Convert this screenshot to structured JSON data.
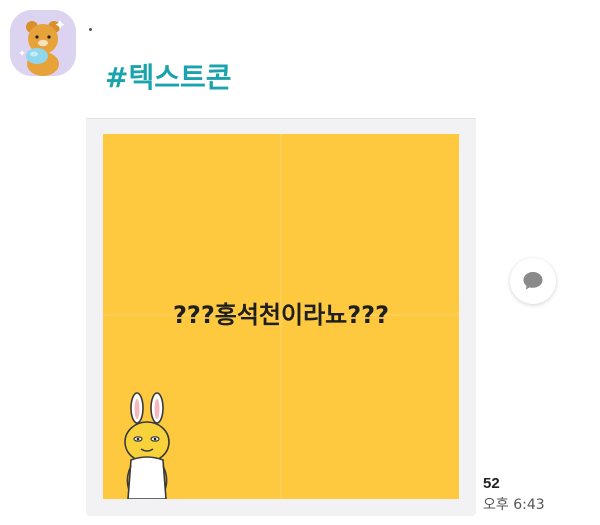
{
  "message": {
    "sender_avatar_icon": "ryan-bear-avatar-icon",
    "avatar_background": "#dcd3f0",
    "hashtag_title": "#텍스트콘",
    "hashtag_color": "#1aa3ad",
    "emoticon": {
      "text": "???홍석천이라뇨???",
      "background_color": "#fec93f",
      "character_icon": "rabbit-character-icon"
    },
    "reply_icon": "speech-bubble-icon",
    "unread_count": "52",
    "timestamp": "오후 6:43"
  }
}
